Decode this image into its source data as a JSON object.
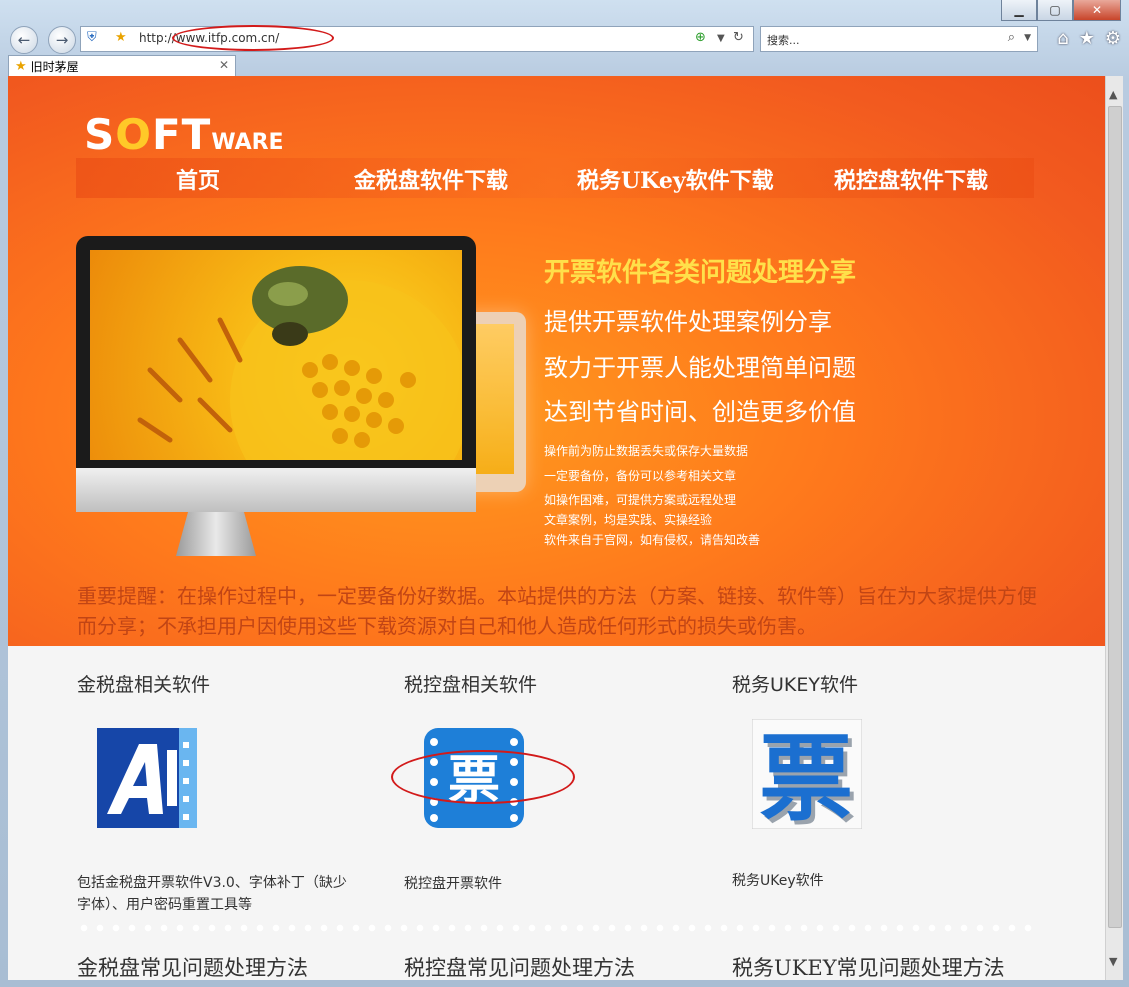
{
  "browser": {
    "url_prefix": "http://",
    "url_rest": "www.itfp.com.cn/",
    "search_placeholder": "搜索...",
    "tab_title": "旧时茅屋"
  },
  "logo": {
    "part1": "S",
    "part_o": "O",
    "part2": "FT",
    "part_small": "WARE"
  },
  "menu": [
    "首页",
    "金税盘软件下载",
    "税务UKey软件下载",
    "税控盘软件下载"
  ],
  "hero": {
    "title": "开票软件各类问题处理分享",
    "line1": "提供开票软件处理案例分享",
    "line2": "致力于开票人能处理简单问题",
    "line3": "达到节省时间、创造更多价值",
    "small": [
      "操作前为防止数据丢失或保存大量数据",
      "一定要备份，备份可以参考相关文章",
      "如操作困难，可提供方案或远程处理",
      "文章案例，均是实践、实操经验",
      "软件来自于官网，如有侵权，请告知改善"
    ]
  },
  "notice": "重要提醒：在操作过程中，一定要备份好数据。本站提供的方法（方案、链接、软件等）旨在为大家提供方便而分享；不承担用户因使用这些下载资源对自己和他人造成任何形式的损失或伤害。",
  "sections": [
    {
      "title": "金税盘相关软件",
      "desc": "包括金税盘开票软件V3.0、字体补丁（缺少字体）、用户密码重置工具等"
    },
    {
      "title": "税控盘相关软件",
      "desc": "税控盘开票软件",
      "icon_text": "票"
    },
    {
      "title": "税务UKEY软件",
      "desc": "税务UKey软件",
      "icon_text": "票"
    }
  ],
  "bottom_titles": [
    "金税盘常见问题处理方法",
    "税控盘常见问题处理方法",
    "税务UKEY常见问题处理方法"
  ],
  "colors": {
    "hero_orange": "#f25a1f",
    "accent_yellow": "#ffe04a",
    "notice_red": "#c14515"
  }
}
